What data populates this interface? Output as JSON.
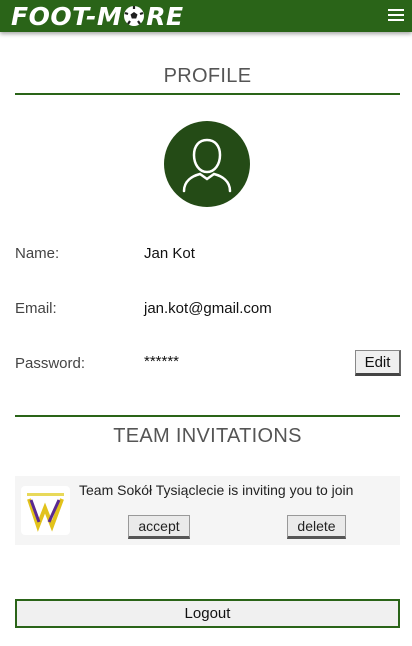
{
  "header": {
    "logo_left": "FOOT-M",
    "logo_right": "RE",
    "menu_icon": "hamburger-menu-icon"
  },
  "profile": {
    "title": "PROFILE",
    "avatar_icon": "user-silhouette-icon",
    "name_label": "Name:",
    "name_value": "Jan Kot",
    "email_label": "Email:",
    "email_value": "jan.kot@gmail.com",
    "password_label": "Password:",
    "password_value": "******",
    "edit_label": "Edit"
  },
  "invitations": {
    "title": "TEAM INVITATIONS",
    "items": [
      {
        "text": "Team Sokół Tysiąclecie is inviting you to join",
        "accept_label": "accept",
        "delete_label": "delete",
        "logo_icon": "team-crest-icon"
      }
    ]
  },
  "logout_label": "Logout",
  "colors": {
    "brand_green": "#2a6418",
    "avatar_green": "#244b16"
  }
}
